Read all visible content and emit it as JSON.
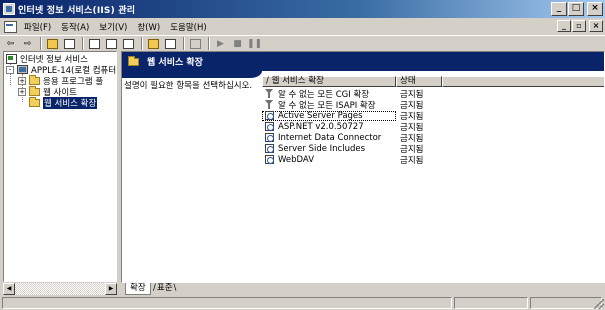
{
  "window": {
    "title": "인터넷 정보 서비스(IIS) 관리",
    "buttons": {
      "minimize": "_",
      "maximize": "□",
      "close": "×"
    }
  },
  "menu": {
    "items": [
      "파일(F)",
      "동작(A)",
      "보기(V)",
      "창(W)",
      "도움말(H)"
    ],
    "mdi_buttons": {
      "minimize": "_",
      "restore": "▫",
      "close": "×"
    }
  },
  "toolbar": {
    "back": "⇦",
    "forward": "⇨",
    "play": "▶",
    "stop": "■",
    "pause": "❚❚"
  },
  "tree": {
    "root": "인터넷 정보 서비스",
    "server": "APPLE-14(로컬 컴퓨터)",
    "children": [
      "응용 프로그램 풀",
      "웹 사이트",
      "웹 서비스 확장"
    ],
    "expanders": {
      "root": "-",
      "server": "-",
      "app_pools": "+",
      "web_sites": "+"
    }
  },
  "scroll": {
    "left": "◀",
    "right": "▶"
  },
  "detail": {
    "header_title": "웹 서비스 확장",
    "description": "설명이 필요한 항목을 선택하십시오.",
    "columns": {
      "name": "웹 서비스 확장",
      "status": "상태",
      "sort_indicator": "/"
    },
    "rows": [
      {
        "icon": "filter-icon",
        "name": "알 수 없는 모든 CGI 확장",
        "status": "금지됨"
      },
      {
        "icon": "filter-icon",
        "name": "알 수 없는 모든 ISAPI 확장",
        "status": "금지됨"
      },
      {
        "icon": "extension-icon",
        "name": "Active Server Pages",
        "status": "금지됨"
      },
      {
        "icon": "extension-icon",
        "name": "ASP.NET v2.0.50727",
        "status": "금지됨"
      },
      {
        "icon": "extension-icon",
        "name": "Internet Data Connector",
        "status": "금지됨"
      },
      {
        "icon": "extension-icon",
        "name": "Server Side Includes",
        "status": "금지됨"
      },
      {
        "icon": "extension-icon",
        "name": "WebDAV",
        "status": "금지됨"
      }
    ],
    "focused_row": 2
  },
  "tabs": [
    "확장",
    "표준"
  ]
}
